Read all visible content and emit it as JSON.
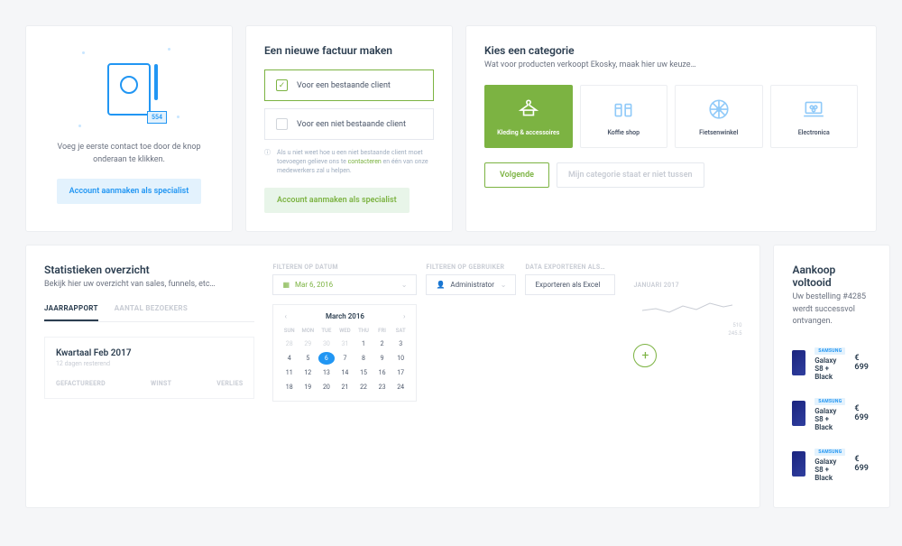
{
  "card1": {
    "badge": "554",
    "sub": "Voeg je eerste contact toe door de knop onderaan te klikken.",
    "btn": "Account aanmaken als specialist"
  },
  "card2": {
    "title": "Een nieuwe factuur maken",
    "opt1": "Voor een bestaande client",
    "opt2": "Voor een niet bestaande client",
    "info": "Als u niet weet hoe u een niet bestaande client moet toevoegen gelieve ons te ",
    "info_link": "contacteren",
    "info2": " en één van onze medewerkers zal u helpen.",
    "btn": "Account aanmaken als specialist"
  },
  "card3": {
    "title": "Kies een categorie",
    "sub": "Wat voor producten verkoopt Ekosky, maak hier uw keuze…",
    "cats": [
      "Kleding & accessoires",
      "Koffie shop",
      "Fietsenwinkel",
      "Electronica"
    ],
    "next": "Volgende",
    "skip": "Mijn categorie staat er niet tussen"
  },
  "stats": {
    "title": "Statistieken overzicht",
    "sub": "Bekijk hier uw overzicht van sales, funnels, etc…",
    "tabs": [
      "JAARRAPPORT",
      "AANTAL BEZOEKERS"
    ],
    "kw": "Kwartaal Feb 2017",
    "kws": "12 dagen resterend",
    "cols": [
      "GEFACTUREERD",
      "WINST",
      "VERLIES"
    ],
    "f1": "FILTEREN OP DATUM",
    "f1v": "Mar 6, 2016",
    "f2": "FILTEREN OP GEBRUIKER",
    "f2v": "Administrator",
    "f3": "DATA EXPORTEREN ALS…",
    "f3v": "Exporteren als Excel",
    "cal_month": "March 2016",
    "dh": [
      "SUN",
      "MON",
      "TUE",
      "WED",
      "THU",
      "FRI",
      "SAT"
    ],
    "weeks": [
      [
        "28",
        "29",
        "30",
        "31",
        "1",
        "2",
        "3"
      ],
      [
        "4",
        "5",
        "6",
        "7",
        "8",
        "9",
        "10"
      ],
      [
        "11",
        "12",
        "13",
        "14",
        "15",
        "16",
        "17"
      ],
      [
        "18",
        "19",
        "20",
        "21",
        "22",
        "23",
        "24"
      ]
    ],
    "spark": "JANUARI 2017",
    "sv1": "510",
    "sv2": "245.5"
  },
  "order": {
    "title": "Aankoop voltooid",
    "sub": "Uw bestelling #4285 werdt successvol ontvangen.",
    "items": [
      {
        "tag": "SAMSUNG",
        "name": "Galaxy S8 + Black",
        "price": "€ 699"
      },
      {
        "tag": "SAMSUNG",
        "name": "Galaxy S8 + Black",
        "price": "€ 699"
      },
      {
        "tag": "SAMSUNG",
        "name": "Galaxy S8 + Black",
        "price": "€ 699"
      }
    ]
  }
}
